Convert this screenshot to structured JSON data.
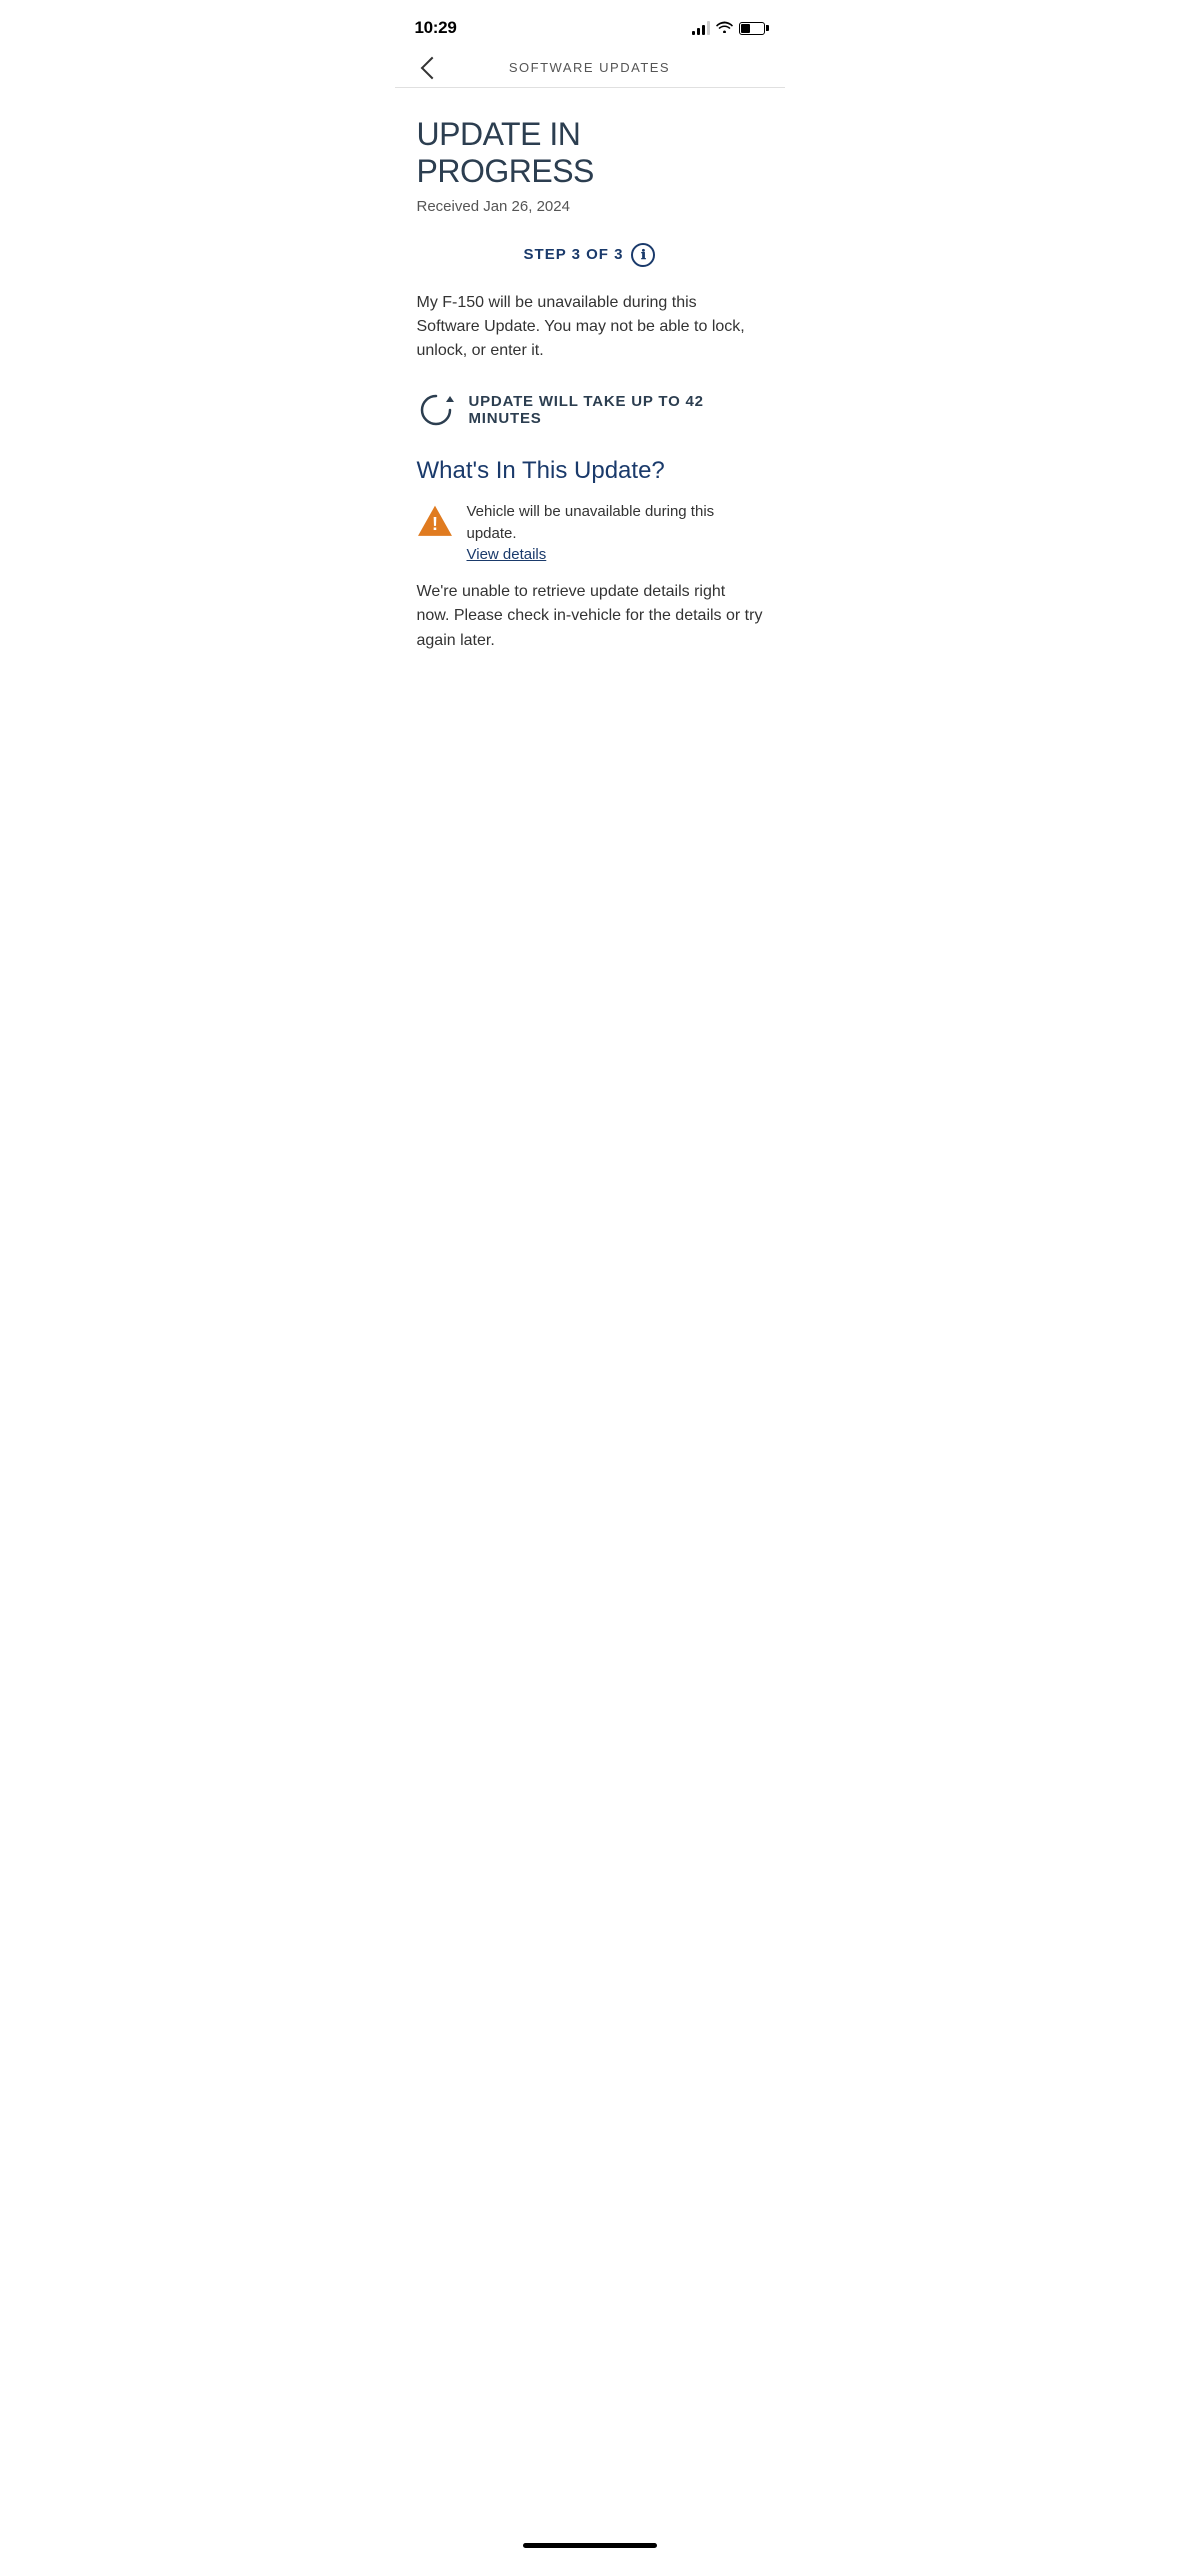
{
  "statusBar": {
    "time": "10:29",
    "batteryLevel": 45
  },
  "navBar": {
    "title": "SOFTWARE UPDATES",
    "backLabel": "Back"
  },
  "main": {
    "updateTitle": "UPDATE IN PROGRESS",
    "receivedLabel": "Received Jan 26, 2024",
    "stepLabel": "STEP 3 OF 3",
    "infoIcon": "ℹ",
    "warningText": "My F-150 will be unavailable during this Software Update. You may not be able to lock, unlock, or enter it.",
    "durationText": "UPDATE WILL TAKE UP TO 42 MINUTES",
    "whatsInTitle": "What's In This Update?",
    "vehicleUnavailableText": "Vehicle will be unavailable during this update.",
    "viewDetailsLabel": "View details",
    "errorText": "We're unable to retrieve update details right now. Please check in-vehicle for the details or try again later."
  },
  "colors": {
    "accent": "#1a3a6b",
    "warning": "#e07b20",
    "text": "#333333",
    "subtext": "#555555"
  }
}
